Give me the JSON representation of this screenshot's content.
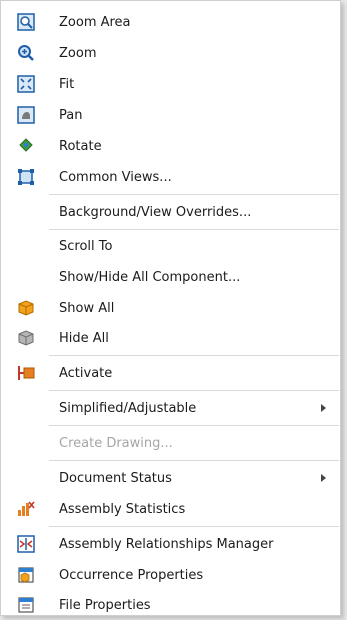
{
  "menu": {
    "items": [
      {
        "label": "Zoom Area",
        "icon": "zoom-area-icon"
      },
      {
        "label": "Zoom",
        "icon": "zoom-icon"
      },
      {
        "label": "Fit",
        "icon": "fit-icon"
      },
      {
        "label": "Pan",
        "icon": "pan-icon"
      },
      {
        "label": "Rotate",
        "icon": "rotate-icon"
      },
      {
        "label": "Common Views...",
        "icon": "common-views-icon"
      },
      {
        "label": "Background/View Overrides..."
      },
      {
        "label": "Scroll To"
      },
      {
        "label": "Show/Hide All Component..."
      },
      {
        "label": "Show All",
        "icon": "show-all-icon"
      },
      {
        "label": "Hide All",
        "icon": "hide-all-icon"
      },
      {
        "label": "Activate",
        "icon": "activate-icon"
      },
      {
        "label": "Simplified/Adjustable",
        "submenu": true
      },
      {
        "label": "Create Drawing...",
        "disabled": true
      },
      {
        "label": "Document Status",
        "submenu": true
      },
      {
        "label": "Assembly Statistics",
        "icon": "assembly-statistics-icon"
      },
      {
        "label": "Assembly Relationships Manager",
        "icon": "assembly-relationships-icon"
      },
      {
        "label": "Occurrence Properties",
        "icon": "occurrence-properties-icon"
      },
      {
        "label": "File Properties",
        "icon": "file-properties-icon"
      }
    ]
  },
  "colors": {
    "menu_bg": "#ffffff",
    "text": "#1b1b1b",
    "disabled_text": "#a6a6a6",
    "separator": "#dadada"
  }
}
